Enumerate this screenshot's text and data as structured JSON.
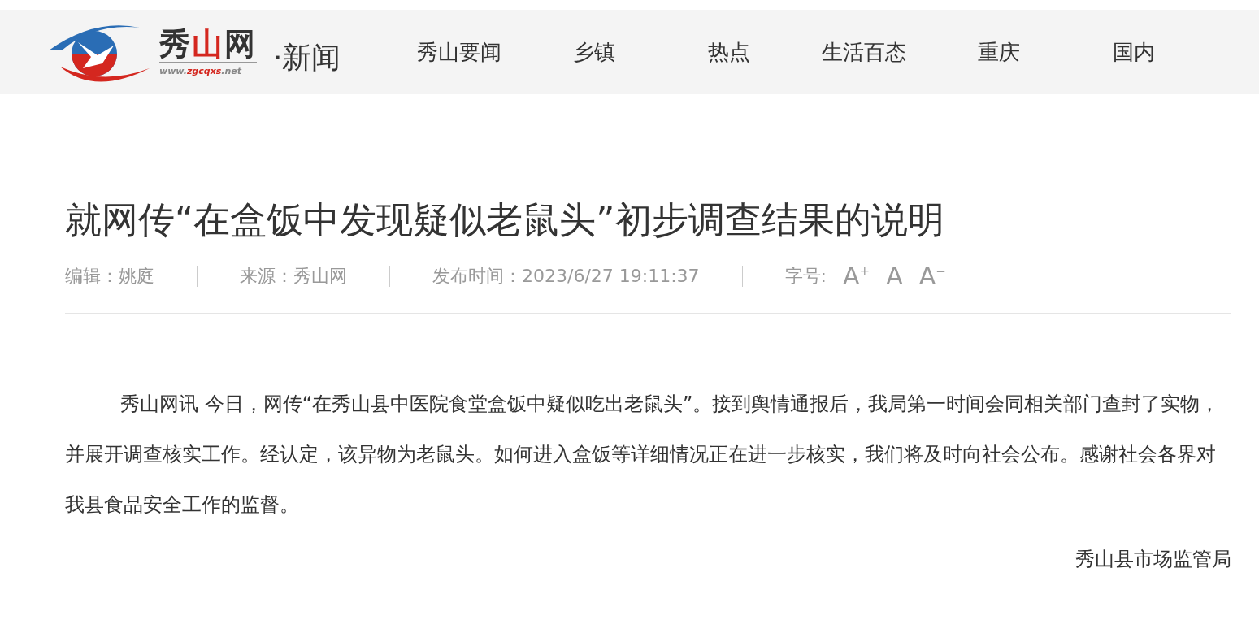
{
  "header": {
    "logo": {
      "name_parts": [
        {
          "text": "秀",
          "color": "#333333"
        },
        {
          "text": "山",
          "color": "#d4271f"
        },
        {
          "text": "网",
          "color": "#333333"
        }
      ],
      "url_parts": [
        {
          "text": "www.",
          "color": "#888888"
        },
        {
          "text": "zgcqxs",
          "color": "#d4271f"
        },
        {
          "text": ".net",
          "color": "#888888"
        }
      ]
    },
    "section": "·新闻",
    "nav": [
      {
        "label": "秀山要闻"
      },
      {
        "label": "乡镇"
      },
      {
        "label": "热点"
      },
      {
        "label": "生活百态"
      },
      {
        "label": "重庆"
      },
      {
        "label": "国内"
      }
    ]
  },
  "article": {
    "title": "就网传“在盒饭中发现疑似老鼠头”初步调查结果的说明",
    "meta": [
      {
        "text": "编辑：姚庭"
      },
      {
        "text": "来源：秀山网"
      },
      {
        "text": "发布时间：2023/6/27 19:11:37"
      }
    ],
    "font_size": {
      "label": "字号:",
      "options": [
        {
          "text": "A$^{+}$"
        },
        {
          "text": "A"
        },
        {
          "text": "A$^{−}$"
        }
      ]
    },
    "body": "秀山网讯 今日，网传“在秀山县中医院食堂盒饭中疑似吃出老鼠头”。接到舆情通报后，我局第一时间会同相关部门查封了实物，并展开调查核实工作。经认定，该异物为老鼠头。如何进入盒饭等详细情况正在进一步核实，我们将及时向社会公布。感谢社会各界对我县食品安全工作的监督。",
    "signature": "秀山县市场监管局"
  }
}
